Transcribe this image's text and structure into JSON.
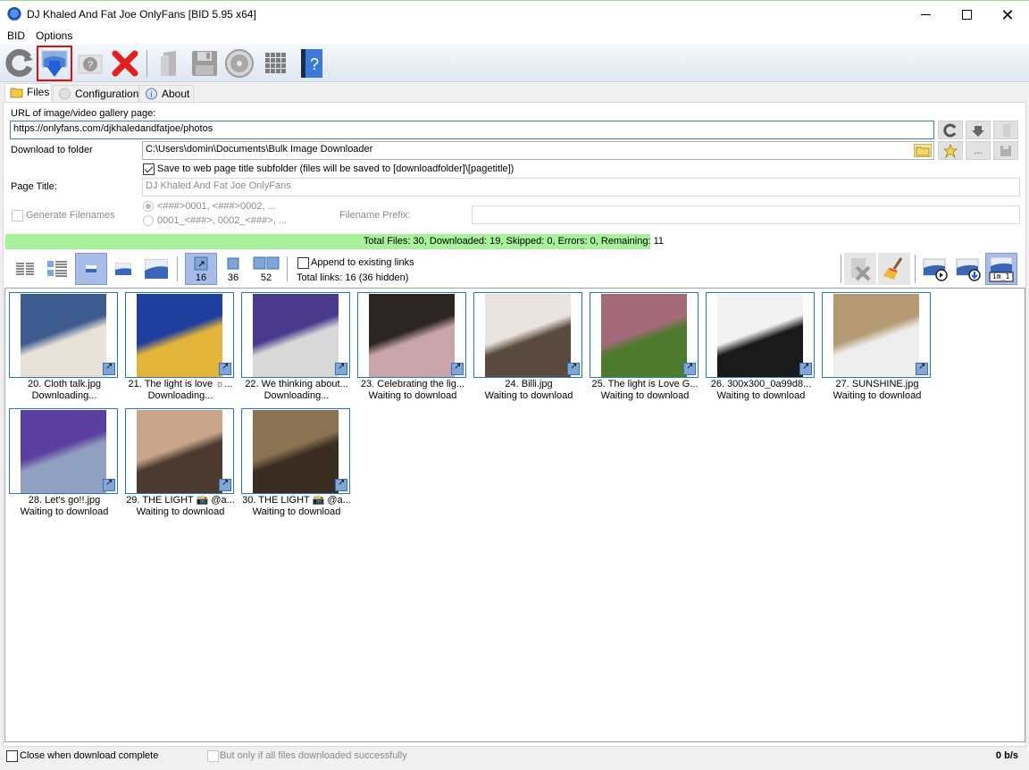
{
  "window": {
    "title": "DJ Khaled And Fat Joe OnlyFans [BID 5.95 x64]",
    "controls": {
      "minimize": "minimize",
      "maximize": "maximize",
      "close": "close"
    }
  },
  "menu": [
    "BID",
    "Options"
  ],
  "toolbar": {
    "buttons": [
      {
        "name": "refresh",
        "icon": "refresh-icon"
      },
      {
        "name": "download",
        "icon": "download-icon",
        "highlighted": true
      },
      {
        "name": "help-query",
        "icon": "question-icon"
      },
      {
        "name": "stop",
        "icon": "red-x-icon"
      },
      {
        "name": "open-folder",
        "icon": "folder-icon"
      },
      {
        "name": "save",
        "icon": "floppy-icon"
      },
      {
        "name": "settings",
        "icon": "gear-icon"
      },
      {
        "name": "grid",
        "icon": "grid-icon"
      },
      {
        "name": "help-book",
        "icon": "help-book-icon"
      }
    ]
  },
  "tabs": [
    {
      "label": "Files",
      "icon": "folder-icon",
      "active": true
    },
    {
      "label": "Configuration",
      "icon": "gear-icon",
      "active": false
    },
    {
      "label": "About",
      "icon": "info-icon",
      "active": false
    }
  ],
  "form": {
    "url_label": "URL of image/video gallery page:",
    "url_value": "https://onlyfans.com/djkhaledandfatjoe/photos",
    "folder_label": "Download to folder",
    "folder_value": "C:\\Users\\domin\\Documents\\Bulk Image Downloader",
    "subfolder_checkbox": "Save to web page title subfolder (files will be saved to [downloadfolder]\\[pagetitle])",
    "subfolder_checked": true,
    "page_title_label": "Page Title:",
    "page_title_value": "DJ Khaled And Fat Joe OnlyFans",
    "generate_filenames_label": "Generate Filenames",
    "generate_filenames_checked": false,
    "radio_option_1": "<###>0001, <###>0002, ...",
    "radio_option_2": "0001_<###>, 0002_<###>, ...",
    "filename_prefix_label": "Filename Prefix:",
    "filename_prefix_value": "",
    "side_buttons": {
      "more": "..."
    }
  },
  "progress": {
    "text_main": "Total Files: 30, Downloaded: 19, Skipped: 0, Errors: 0, Remaining: ",
    "remaining": "11",
    "total": 30,
    "downloaded": 19,
    "fraction": 0.633
  },
  "view": {
    "counts": [
      "16",
      "36",
      "52"
    ],
    "append_label": "Append to existing links",
    "append_checked": false,
    "total_links": "Total links: 16 (36 hidden)",
    "overlay_label": "im_1"
  },
  "items": [
    {
      "caption": "20. Cloth talk.jpg",
      "status": "Downloading...",
      "c1": "#3d5b8f",
      "c2": "#e8e2d8"
    },
    {
      "caption": "21. The light is love ☼...",
      "status": "Downloading...",
      "c1": "#1f3f9e",
      "c2": "#e2b43a"
    },
    {
      "caption": "22. We thinking about...",
      "status": "Downloading...",
      "c1": "#4a3a8c",
      "c2": "#d8d8d8"
    },
    {
      "caption": "23. Celebrating the lig...",
      "status": "Waiting to download",
      "c1": "#2b2624",
      "c2": "#c9a4a8"
    },
    {
      "caption": "24. Billi.jpg",
      "status": "Waiting to download",
      "c1": "#e9e4df",
      "c2": "#5a4a40"
    },
    {
      "caption": "25. The light is Love G...",
      "status": "Waiting to download",
      "c1": "#a56a7a",
      "c2": "#4e7a2e"
    },
    {
      "caption": "26. 300x300_0a99d8...",
      "status": "Waiting to download",
      "c1": "#f2f2f2",
      "c2": "#1a1a1a"
    },
    {
      "caption": "27. SUNSHINE.jpg",
      "status": "Waiting to download",
      "c1": "#b59a74",
      "c2": "#eeeeee"
    },
    {
      "caption": "28. Let’s go!!.jpg",
      "status": "Waiting to download",
      "c1": "#5b3fa0",
      "c2": "#8fa0c0"
    },
    {
      "caption": "29. THE LIGHT 📸 @a...",
      "status": "Waiting to download",
      "c1": "#c9a68a",
      "c2": "#4a3a30"
    },
    {
      "caption": "30. THE LIGHT 📸 @a...",
      "status": "Waiting to download",
      "c1": "#8a7352",
      "c2": "#3a2e22"
    }
  ],
  "bottom": {
    "close_when_complete": "Close when download complete",
    "close_checked": false,
    "only_if_success": "But only if all files downloaded successfully",
    "speed": "0 b/s"
  }
}
